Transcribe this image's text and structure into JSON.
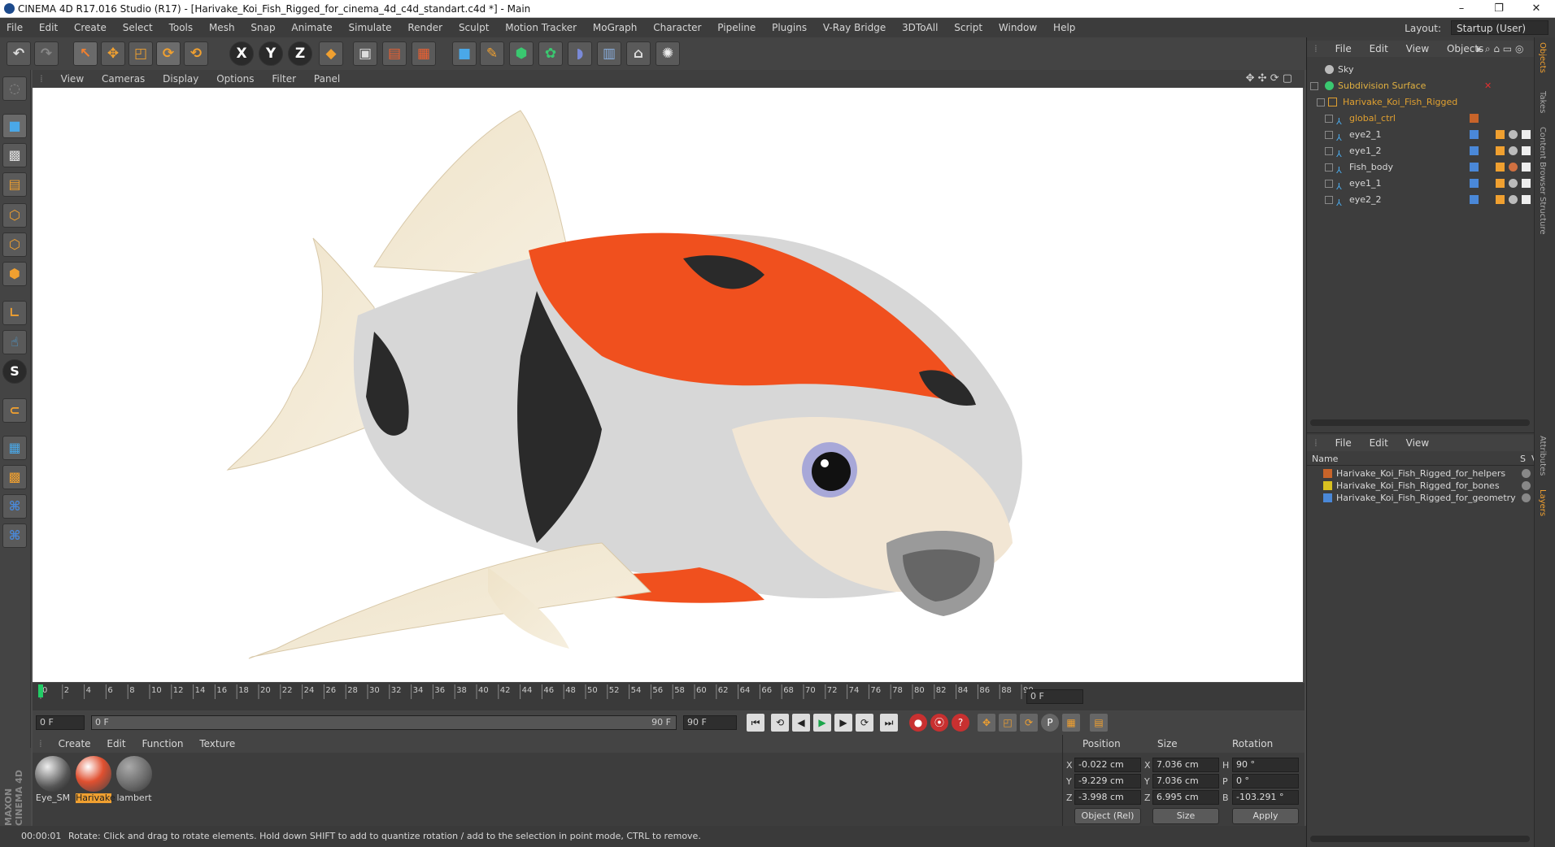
{
  "window": {
    "title": "CINEMA 4D R17.016 Studio (R17) - [Harivake_Koi_Fish_Rigged_for_cinema_4d_c4d_standart.c4d *] - Main",
    "controls": [
      "–",
      "❐",
      "✕"
    ]
  },
  "menubar": {
    "items": [
      "File",
      "Edit",
      "Create",
      "Select",
      "Tools",
      "Mesh",
      "Snap",
      "Animate",
      "Simulate",
      "Render",
      "Sculpt",
      "Motion Tracker",
      "MoGraph",
      "Character",
      "Pipeline",
      "Plugins",
      "V-Ray Bridge",
      "3DToAll",
      "Script",
      "Window",
      "Help"
    ],
    "layout_label": "Layout:",
    "layout_value": "Startup (User)"
  },
  "toolbar": {
    "axis": [
      "X",
      "Y",
      "Z"
    ]
  },
  "viewport": {
    "menu": [
      "View",
      "Cameras",
      "Display",
      "Options",
      "Filter",
      "Panel"
    ]
  },
  "timeline": {
    "ticks": [
      "0",
      "2",
      "4",
      "6",
      "8",
      "10",
      "12",
      "14",
      "16",
      "18",
      "20",
      "22",
      "24",
      "26",
      "28",
      "30",
      "32",
      "34",
      "36",
      "38",
      "40",
      "42",
      "44",
      "46",
      "48",
      "50",
      "52",
      "54",
      "56",
      "58",
      "60",
      "62",
      "64",
      "66",
      "68",
      "70",
      "72",
      "74",
      "76",
      "78",
      "80",
      "82",
      "84",
      "86",
      "88",
      "90"
    ],
    "current_frame": "0 F",
    "start": "0 F",
    "range_start": "0 F",
    "range_end": "90 F",
    "end": "90 F"
  },
  "materials": {
    "menu": [
      "Create",
      "Edit",
      "Function",
      "Texture"
    ],
    "items": [
      {
        "name": "Eye_SM"
      },
      {
        "name": "Harivake"
      },
      {
        "name": "lambert"
      }
    ]
  },
  "coordinates": {
    "headers": {
      "position": "Position",
      "size": "Size",
      "rotation": "Rotation"
    },
    "rows": [
      {
        "axis": "X",
        "pos": "-0.022 cm",
        "size_axis": "X",
        "size": "7.036 cm",
        "rot_axis": "H",
        "rot": "90 °"
      },
      {
        "axis": "Y",
        "pos": "-9.229 cm",
        "size_axis": "Y",
        "size": "7.036 cm",
        "rot_axis": "P",
        "rot": "0 °"
      },
      {
        "axis": "Z",
        "pos": "-3.998 cm",
        "size_axis": "Z",
        "size": "6.995 cm",
        "rot_axis": "B",
        "rot": "-103.291 °"
      }
    ],
    "mode": "Object (Rel)",
    "size_mode": "Size",
    "apply": "Apply"
  },
  "objects": {
    "menu": [
      "File",
      "Edit",
      "View",
      "Objects"
    ],
    "items": [
      {
        "name": "Sky",
        "color": "#c8c8c8"
      },
      {
        "name": "Subdivision Surface",
        "color": "#e0b040"
      },
      {
        "name": "Harivake_Koi_Fish_Rigged",
        "color": "#e0a030"
      },
      {
        "name": "global_ctrl",
        "color": "#e0a030"
      },
      {
        "name": "eye2_1",
        "color": "#d8d8d8"
      },
      {
        "name": "eye1_2",
        "color": "#d8d8d8"
      },
      {
        "name": "Fish_body",
        "color": "#d8d8d8"
      },
      {
        "name": "eye1_1",
        "color": "#d8d8d8"
      },
      {
        "name": "eye2_2",
        "color": "#d8d8d8"
      }
    ]
  },
  "layers": {
    "menu": [
      "File",
      "Edit",
      "View"
    ],
    "header_name": "Name",
    "header_s": "S",
    "header_v": "V",
    "items": [
      {
        "name": "Harivake_Koi_Fish_Rigged_for_helpers",
        "color": "#c8642a"
      },
      {
        "name": "Harivake_Koi_Fish_Rigged_for_bones",
        "color": "#d8c020"
      },
      {
        "name": "Harivake_Koi_Fish_Rigged_for_geometry",
        "color": "#4a88d8"
      }
    ]
  },
  "right_tabs": [
    "Objects",
    "Takes",
    "Content Browser",
    "Structure",
    "Attributes",
    "Layers"
  ],
  "brand": "MAXON CINEMA 4D",
  "status": {
    "time": "00:00:01",
    "message": "Rotate: Click and drag to rotate elements. Hold down SHIFT to add to quantize rotation / add to the selection in point mode, CTRL to remove."
  },
  "colors": {
    "accent": "#f0a030",
    "playhead": "#22cc66",
    "fish_orange": "#f0501e"
  }
}
